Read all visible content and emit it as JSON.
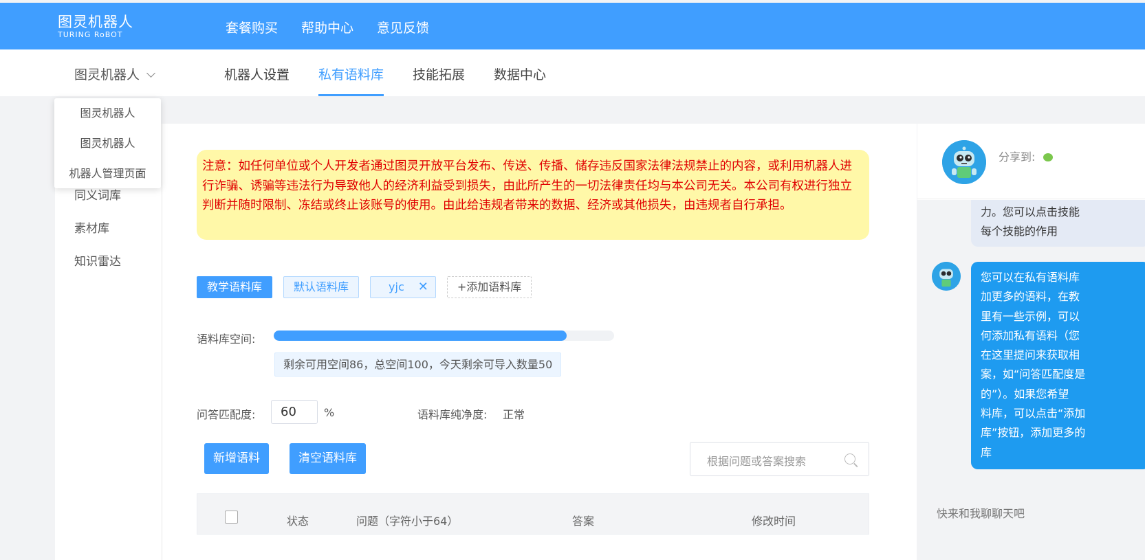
{
  "header": {
    "logo_cn": "图灵机器人",
    "logo_en": "TURING RoBOT",
    "nav": [
      "套餐购买",
      "帮助中心",
      "意见反馈"
    ]
  },
  "subnav": {
    "robot_name": "图灵机器人",
    "tabs": [
      "机器人设置",
      "私有语料库",
      "技能拓展",
      "数据中心"
    ],
    "active_tab": "私有语料库"
  },
  "dropdown": {
    "items": [
      "图灵机器人",
      "图灵机器人",
      "机器人管理页面"
    ]
  },
  "sidebar": {
    "items": [
      "同义词库",
      "素材库",
      "知识雷达"
    ]
  },
  "notice": {
    "text": "注意：如任何单位或个人开发者通过图灵开放平台发布、传送、传播、储存违反国家法律法规禁止的内容，或利用机器人进行诈骗、诱骗等违法行为导致他人的经济利益受到损失，由此所产生的一切法律责任均与本公司无关。本公司有权进行独立判断并随时限制、冻结或终止该账号的使用。由此给违规者带来的数据、经济或其他损失，由违规者自行承担。"
  },
  "corpus_tags": {
    "items": [
      "教学语料库",
      "默认语料库",
      "yjc"
    ],
    "close_symbol": "✕",
    "add_label": "+添加语料库"
  },
  "space": {
    "label": "语料库空间:",
    "used_fraction": 0.86,
    "info": "剩余可用空间86，总空间100，今天剩余可导入数量50"
  },
  "match": {
    "label": "问答匹配度:",
    "value": "60",
    "unit": "%",
    "purity_label": "语料库纯净度:",
    "purity_value": "正常"
  },
  "actions": {
    "add": "新增语料",
    "clear": "清空语料库",
    "search_placeholder": "根据问题或答案搜索"
  },
  "table": {
    "headers": [
      "状态",
      "问题（字符小于64）",
      "答案",
      "修改时间"
    ]
  },
  "chat": {
    "share_label": "分享到:",
    "msg1": [
      "力。您可以点击技能",
      "每个技能的作用"
    ],
    "msg2": [
      "您可以在私有语料库",
      "加更多的语料，在教",
      "里有一些示例，可以",
      "何添加私有语料（您",
      "在这里提问来获取相",
      "案，如“问答匹配度是",
      "的”）。如果您希望",
      "料库，可以点击“添加",
      "库”按钮，添加更多的",
      "库"
    ],
    "input_hint": "快来和我聊聊天吧"
  },
  "colors": {
    "primary": "#409eff",
    "notice_bg": "#fff8a8",
    "notice_text": "#e00000",
    "chat_bubble": "#1e9bf0"
  }
}
